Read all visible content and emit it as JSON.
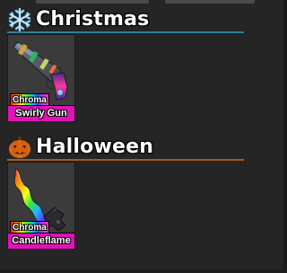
{
  "sections": [
    {
      "title": "Christmas",
      "icon": "snowflake-icon",
      "accent_color": "#2f7f95",
      "items": [
        {
          "name": "Swirly Gun",
          "tag": "Chroma",
          "icon": "swirly-gun-icon",
          "rarity_color": "#e012b8"
        }
      ]
    },
    {
      "title": "Halloween",
      "icon": "jack-o-lantern-icon",
      "accent_color": "#a85a1a",
      "items": [
        {
          "name": "Candleflame",
          "tag": "Chroma",
          "icon": "candleflame-knife-icon",
          "rarity_color": "#e012b8"
        }
      ]
    }
  ]
}
